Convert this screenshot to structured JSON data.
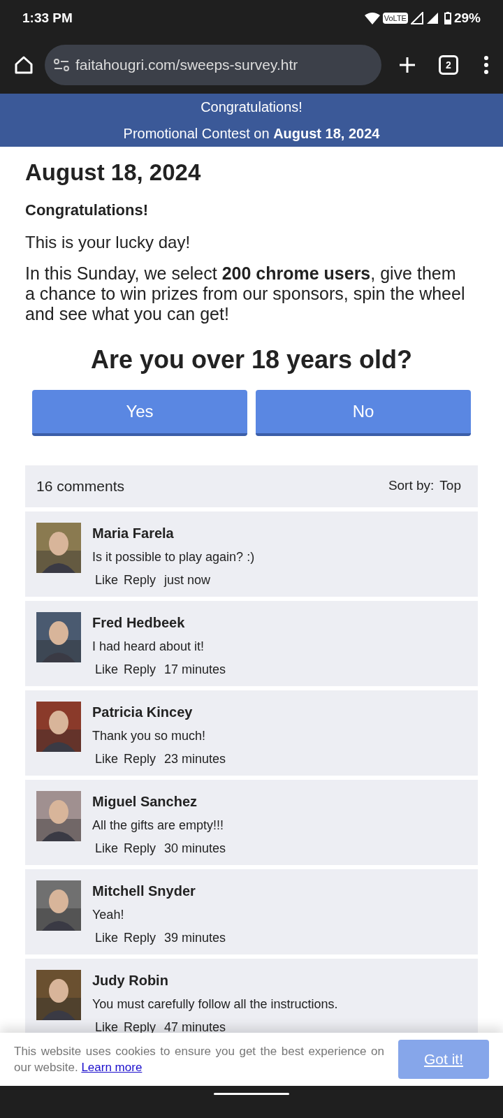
{
  "status_bar": {
    "time": "1:33 PM",
    "network": "VoLTE",
    "battery": "29%"
  },
  "browser": {
    "url": "faitahougri.com/sweeps-survey.htr",
    "tab_count": "2"
  },
  "banner": {
    "title": "Congratulations!",
    "subtitle": "Promotional Contest on **August 18, 2024**"
  },
  "article": {
    "date": "August 18, 2024",
    "heading": "Congratulations!",
    "lead": "This is your lucky day!",
    "body": "In this Sunday, we select **200 chrome users**, give them a chance to win prizes from our sponsors, spin the wheel and see what you can get!"
  },
  "question": {
    "text": "Are you over 18 years old?",
    "buttons": [
      "Yes",
      "No"
    ]
  },
  "comments": {
    "count": "16 comments",
    "sort_label": "Sort by:",
    "sort_value": "Top",
    "items": [
      {
        "name": "Maria Farela",
        "text": "Is it possible to play again? :)",
        "like": "Like",
        "reply": "Reply",
        "time": "just now",
        "color": "#8a7a50"
      },
      {
        "name": "Fred Hedbeek",
        "text": "I had heard about it!",
        "like": "Like",
        "reply": "Reply",
        "time": "17 minutes",
        "color": "#4a5a70"
      },
      {
        "name": "Patricia Kincey",
        "text": "Thank you so much!",
        "like": "Like",
        "reply": "Reply",
        "time": "23 minutes",
        "color": "#8a3a2a"
      },
      {
        "name": "Miguel Sanchez",
        "text": "All the gifts are empty!!!",
        "like": "Like",
        "reply": "Reply",
        "time": "30 minutes",
        "color": "#a09090"
      },
      {
        "name": "Mitchell Snyder",
        "text": "Yeah!",
        "like": "Like",
        "reply": "Reply",
        "time": "39 minutes",
        "color": "#707070"
      },
      {
        "name": "Judy Robin",
        "text": "You must carefully follow all the instructions.",
        "like": "Like",
        "reply": "Reply",
        "time": "47 minutes",
        "color": "#6a5030"
      }
    ]
  },
  "cookie_notice": {
    "text": "This website uses cookies to ensure you get the best experience on our website.",
    "link": "Learn more",
    "button": "Got it!"
  }
}
